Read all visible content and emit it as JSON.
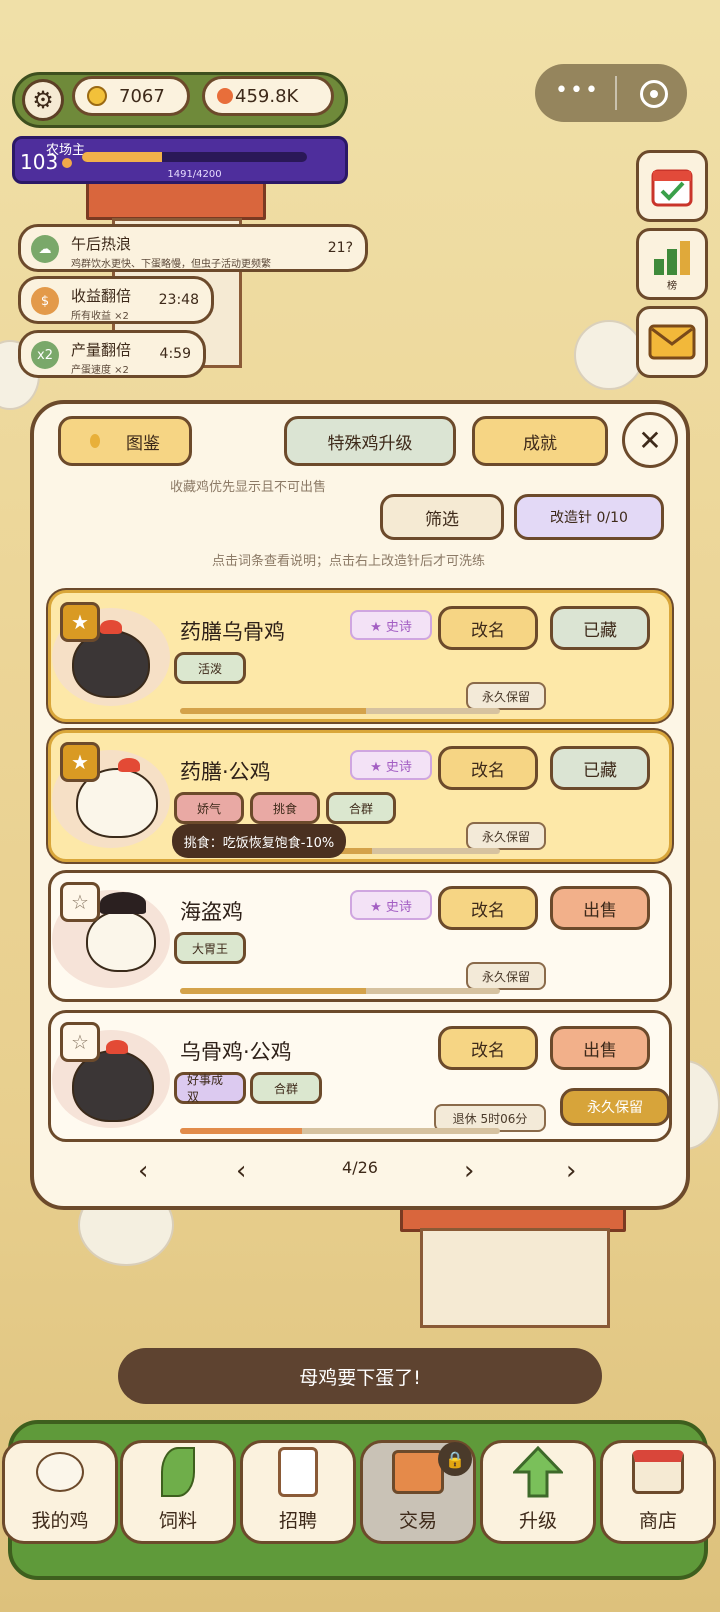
{
  "hud": {
    "coins": "7067",
    "gems": "459.8K",
    "level": "103",
    "title": "农场主",
    "xp_text": "1491/4200",
    "xp_fraction": 0.355
  },
  "buffs": [
    {
      "title": "午后热浪",
      "desc": "鸡群饮水更快、下蛋略慢，但虫子活动更频繁",
      "time": "21?",
      "icon": "cloud-icon",
      "color": "#7aa86a"
    },
    {
      "title": "收益翻倍",
      "desc": "所有收益 ×2",
      "time": "23:48",
      "icon": "dollar-icon",
      "color": "#e39a4a"
    },
    {
      "title": "产量翻倍",
      "desc": "产蛋速度 ×2",
      "time": "4:59",
      "icon": "x2-icon",
      "icon_text": "x2",
      "color": "#7aa86a"
    }
  ],
  "side": {
    "ranking_label": "榜",
    "calendar_icon": "calendar-check-icon",
    "mail_icon": "mail-icon"
  },
  "modal": {
    "tab_codex": "图鉴",
    "tab_special_upgrade": "特殊鸡升级",
    "tab_achievements": "成就",
    "note_collect": "收藏鸡优先显示且不可出售",
    "filter": "筛选",
    "needle": "改造针 0/10",
    "hint": "点击词条查看说明；点击右上改造针后才可洗练",
    "rename": "改名",
    "collected": "已藏",
    "sell": "出售",
    "keep_forever": "永久保留",
    "page": "4/26",
    "tooltip": "挑食：吃饭恢复饱食-10%"
  },
  "cards": [
    {
      "name": "药膳乌骨鸡",
      "rarity": "★ 史诗",
      "tags": [
        "活泼"
      ],
      "keep": "永久保留",
      "fav": true,
      "progress": 0.58
    },
    {
      "name": "药膳·公鸡",
      "rarity": "★ 史诗",
      "tags": [
        "娇气",
        "挑食",
        "合群"
      ],
      "keep": "永久保留",
      "fav": true,
      "progress": 0.6
    },
    {
      "name": "海盗鸡",
      "rarity": "★ 史诗",
      "tags": [
        "大胃王"
      ],
      "keep": "永久保留",
      "fav": false,
      "progress": 0.58
    },
    {
      "name": "乌骨鸡·公鸡",
      "rarity": "",
      "tags": [
        "好事成双",
        "合群"
      ],
      "keep": "退休 5时06分",
      "fav": false,
      "progress": 0.38
    }
  ],
  "toast": "母鸡要下蛋了!",
  "tabs": [
    "我的鸡",
    "饲料",
    "招聘",
    "交易",
    "升级",
    "商店"
  ],
  "colors": {
    "accent_green": "#6f8a3a",
    "modal_bg": "#fdf6e6",
    "level_bar": "#4e2e9c"
  }
}
